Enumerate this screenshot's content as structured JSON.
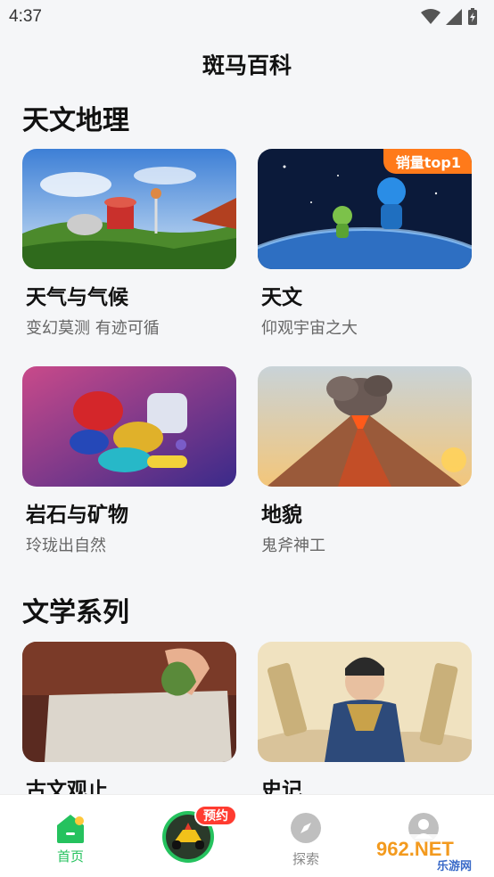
{
  "status_bar": {
    "time": "4:37"
  },
  "header": {
    "title": "斑马百科"
  },
  "sections": [
    {
      "title": "天文地理",
      "cards": [
        {
          "title": "天气与气候",
          "subtitle": "变幻莫测 有迹可循",
          "badge": ""
        },
        {
          "title": "天文",
          "subtitle": "仰观宇宙之大",
          "badge": "销量top1"
        },
        {
          "title": "岩石与矿物",
          "subtitle": "玲珑出自然",
          "badge": ""
        },
        {
          "title": "地貌",
          "subtitle": "鬼斧神工",
          "badge": ""
        }
      ]
    },
    {
      "title": "文学系列",
      "cards": [
        {
          "title": "古文观止",
          "subtitle": "",
          "badge": ""
        },
        {
          "title": "史记",
          "subtitle": "",
          "badge": ""
        }
      ]
    }
  ],
  "tab_bar": {
    "home_label": "首页",
    "center_badge": "预约",
    "explore_label": "探索",
    "accent_color": "#25c25e"
  },
  "watermark": {
    "text_main": "962.NET",
    "text_sub": "乐游网"
  }
}
